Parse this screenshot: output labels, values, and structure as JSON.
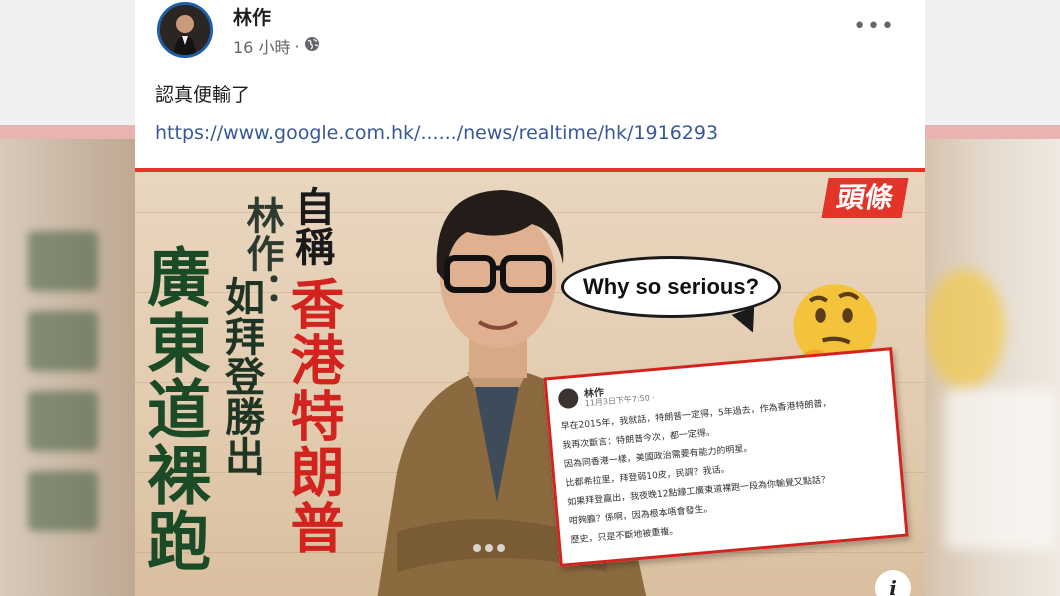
{
  "post": {
    "author": "林作",
    "time": "16 小時",
    "dot": "·",
    "privacy_icon": "globe-icon",
    "more_label": "•••",
    "text": "認真便輸了",
    "link": "https://www.google.com.hk/....../news/realtime/hk/1916293"
  },
  "shared_image": {
    "logo": "頭條",
    "speech_bubble": "Why so serious?",
    "headline_name": "林作：",
    "headline_condition": "如拜登勝出",
    "headline_action": "廣東道裸跑",
    "headline_title_prefix": "自稱",
    "headline_title": "香港特朗普",
    "emoji": "thinking-face-icon",
    "embedded_post": {
      "author": "林作",
      "date": "11月3日下午7:50 ·",
      "lines": [
        "早在2015年，我就話，特朗普一定得，5年過去，作為香港特朗普，",
        "我再次斷言：特朗普今次，都一定得。",
        "因為同香港一樣，美國政治需要有能力的明星。",
        "比都希拉里，拜登弱10皮，民調？我话。",
        "如果拜登贏出，我夜晚12點鐘工廣東道裸跑一段為你輸覺又點話？",
        "咁夠膽？係啊，因為根本唔會發生。",
        "歷史，只是不斷地被重複。"
      ]
    },
    "info_label": "i"
  },
  "colors": {
    "brand_blue": "#1f5ea8",
    "link_blue": "#385898",
    "accent_red": "#e4342a",
    "headline_red": "#d3231e",
    "headline_green": "#1a4a26"
  }
}
